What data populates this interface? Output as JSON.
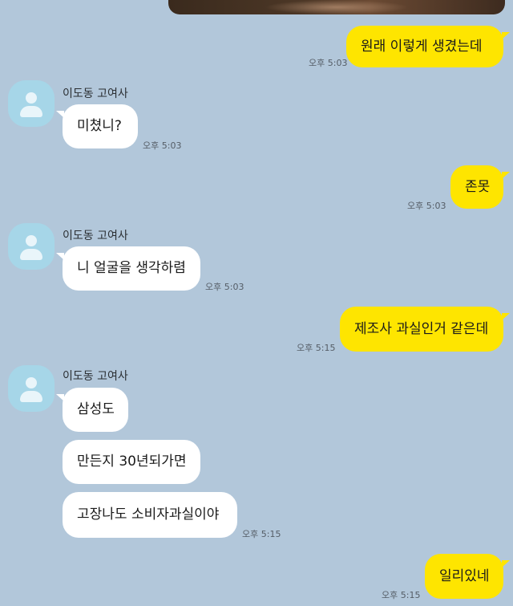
{
  "sender_name": "이도동 고여사",
  "messages": [
    {
      "text": "원래 이렇게 생겼는데",
      "time": "오후 5:03"
    },
    {
      "text": "미쳤니?",
      "time": "오후 5:03"
    },
    {
      "text": "존못",
      "time": "오후 5:03"
    },
    {
      "text": "니 얼굴을 생각하렴",
      "time": "오후 5:03"
    },
    {
      "text": "제조사 과실인거 같은데",
      "time": "오후 5:15"
    },
    {
      "text": "삼성도"
    },
    {
      "text": "만든지 30년되가면"
    },
    {
      "text": "고장나도 소비자과실이야",
      "time": "오후 5:15"
    },
    {
      "text": "일리있네",
      "time": "오후 5:15"
    }
  ],
  "colors": {
    "background": "#b2c7da",
    "my_bubble": "#fee500",
    "other_bubble": "#ffffff",
    "avatar": "#a6d6e8"
  }
}
